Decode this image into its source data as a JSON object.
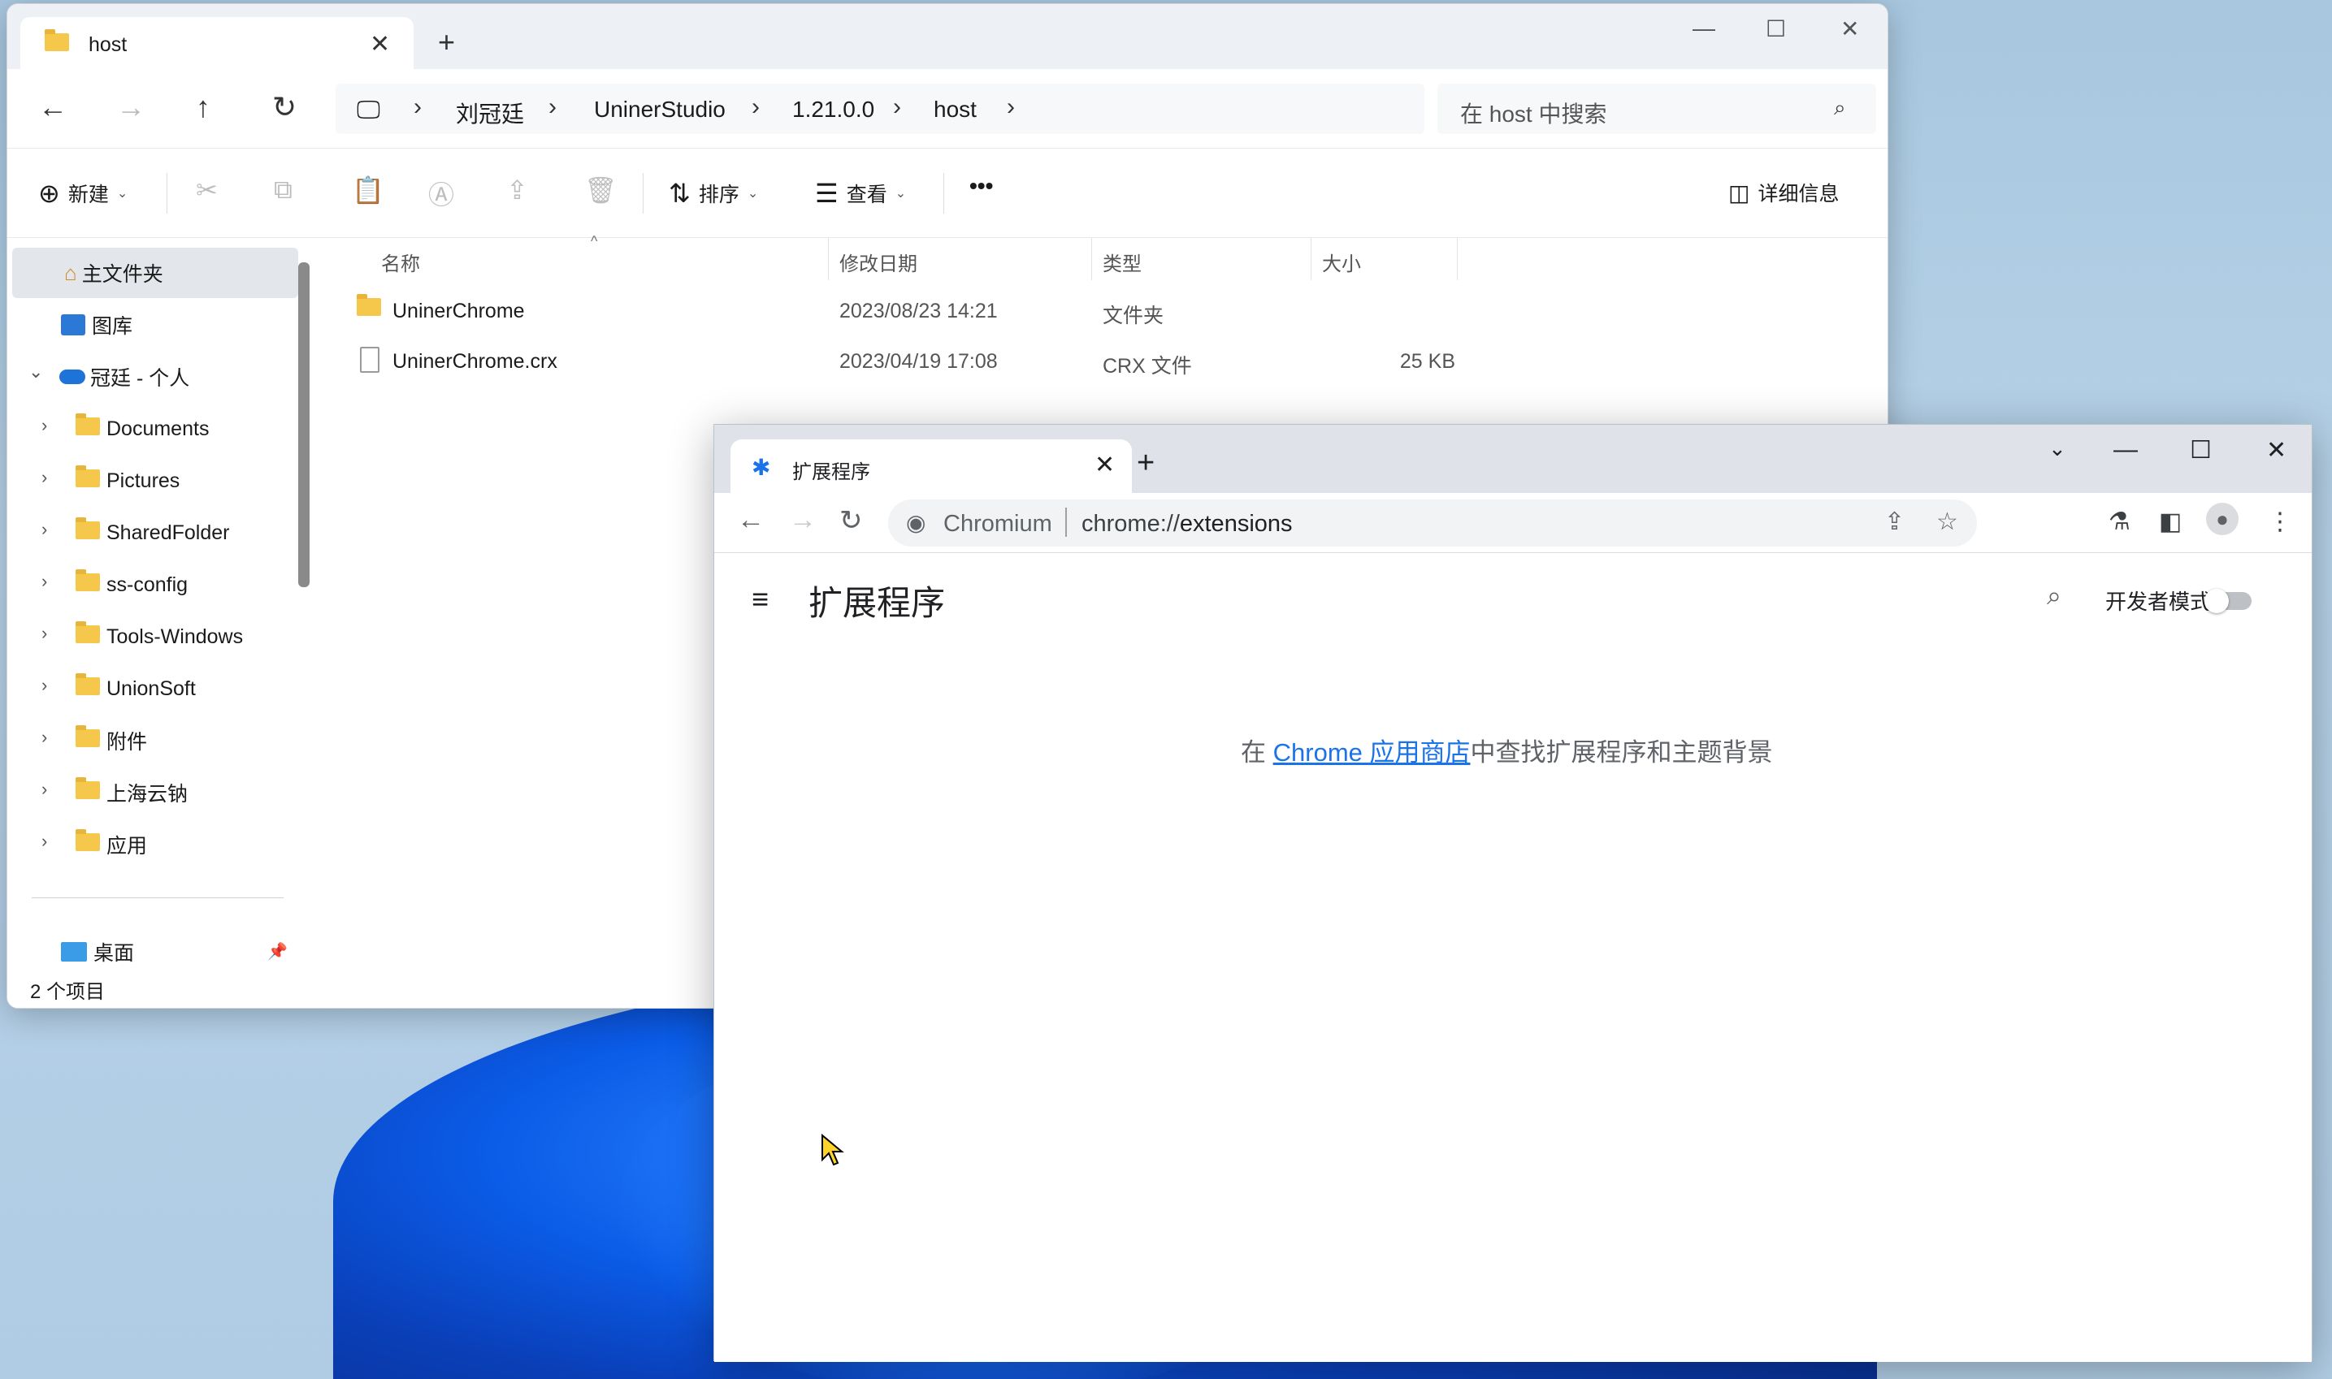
{
  "explorer": {
    "tab_title": "host",
    "nav": {
      "back": "←",
      "forward": "→",
      "up": "↑",
      "refresh": "↻"
    },
    "breadcrumb": [
      "刘冠廷",
      "UninerStudio",
      "1.21.0.0",
      "host"
    ],
    "search_placeholder": "在 host 中搜索",
    "toolbar": {
      "new_label": "新建",
      "sort_label": "排序",
      "view_label": "查看",
      "more_label": "•••",
      "details_label": "详细信息"
    },
    "sidebar": {
      "items": [
        {
          "label": "主文件夹"
        },
        {
          "label": "图库"
        },
        {
          "label": "冠廷 - 个人"
        },
        {
          "label": "Documents"
        },
        {
          "label": "Pictures"
        },
        {
          "label": "SharedFolder"
        },
        {
          "label": "ss-config"
        },
        {
          "label": "Tools-Windows"
        },
        {
          "label": "UnionSoft"
        },
        {
          "label": "附件"
        },
        {
          "label": "上海云钠"
        },
        {
          "label": "应用"
        },
        {
          "label": "桌面"
        }
      ]
    },
    "columns": [
      "名称",
      "修改日期",
      "类型",
      "大小"
    ],
    "files": [
      {
        "name": "UninerChrome",
        "modified": "2023/08/23 14:21",
        "type": "文件夹",
        "size": ""
      },
      {
        "name": "UninerChrome.crx",
        "modified": "2023/04/19 17:08",
        "type": "CRX 文件",
        "size": "25 KB"
      }
    ],
    "status": "2 个项目"
  },
  "chromium": {
    "tab_title": "扩展程序",
    "origin_label": "Chromium",
    "url_scheme": "chrome://",
    "url_host": "extensions",
    "page_title": "扩展程序",
    "dev_mode_label": "开发者模式",
    "dev_mode_on": false,
    "empty_prefix": "在 ",
    "empty_link": "Chrome 应用商店",
    "empty_suffix": "中查找扩展程序和主题背景"
  }
}
